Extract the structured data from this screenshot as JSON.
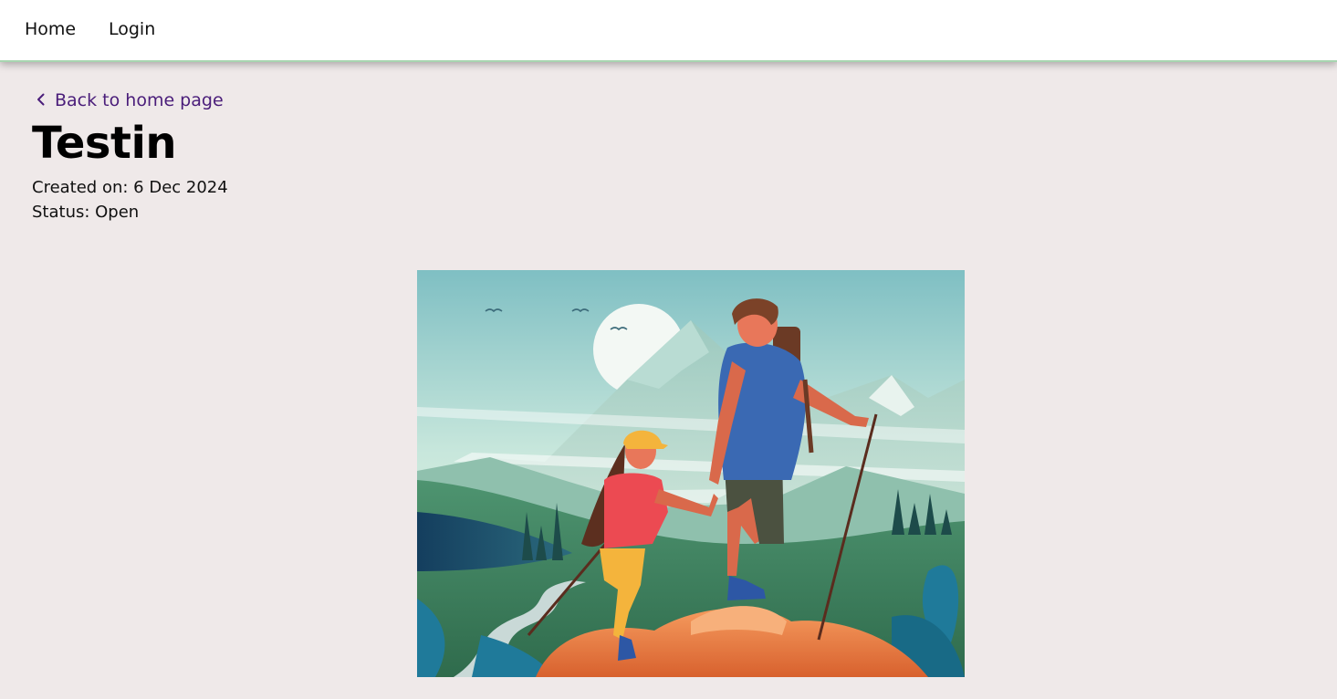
{
  "nav": {
    "home_label": "Home",
    "login_label": "Login"
  },
  "back_link": {
    "label": "Back to home page",
    "icon": "chevron-left-icon"
  },
  "listing": {
    "title": "Testin",
    "created_on": "Created on: 6 Dec 2024",
    "status": "Status: Open"
  },
  "image": {
    "subject": "hiking-illustration"
  },
  "colors": {
    "background": "#efe9e9",
    "nav_background": "#ffffff",
    "nav_border": "#a7d5b0",
    "link": "#4a1d7a",
    "text": "#111111"
  }
}
